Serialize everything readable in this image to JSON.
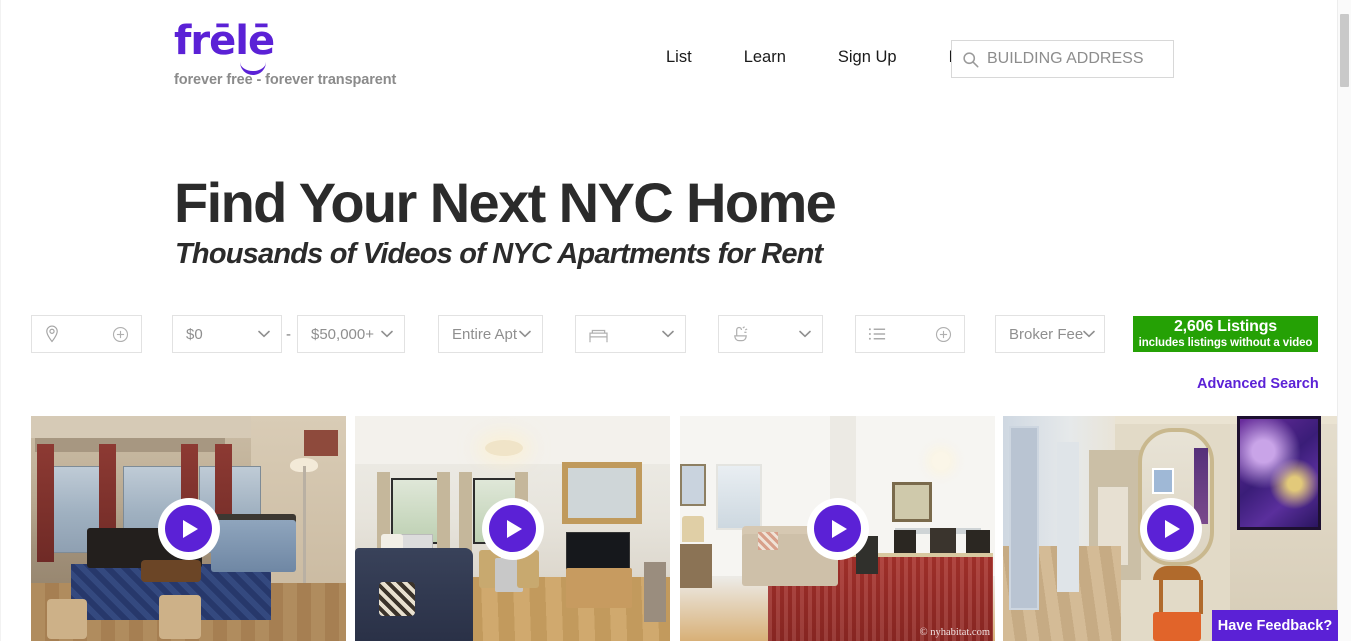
{
  "header": {
    "logo_text": "frēlē",
    "tagline": "forever free - forever transparent",
    "nav": [
      {
        "label": "List"
      },
      {
        "label": "Learn"
      },
      {
        "label": "Sign Up"
      },
      {
        "label": "Login"
      }
    ],
    "search": {
      "placeholder": "BUILDING ADDRESS",
      "value": "",
      "icon": "search-icon"
    }
  },
  "hero": {
    "title": "Find Your Next NYC Home",
    "subtitle": "Thousands of Videos of NYC Apartments for Rent"
  },
  "filters": {
    "neighborhood": {
      "icon": "location-pin-icon",
      "add_icon": "circle-plus-icon",
      "value": ""
    },
    "price_min": {
      "value": "$0",
      "chevron": "chevron-down-icon"
    },
    "price_separator": "-",
    "price_max": {
      "value": "$50,000+",
      "chevron": "chevron-down-icon"
    },
    "apartment_type": {
      "value": "Entire Apt",
      "chevron": "chevron-down-icon"
    },
    "bedrooms": {
      "icon": "bed-icon",
      "value": "",
      "chevron": "chevron-down-icon"
    },
    "bathrooms": {
      "icon": "shower-icon",
      "value": "",
      "chevron": "chevron-down-icon"
    },
    "amenities": {
      "icon": "list-icon",
      "add_icon": "circle-plus-icon",
      "value": ""
    },
    "broker_fee": {
      "value": "Broker Fee",
      "chevron": "chevron-down-icon"
    },
    "listings_button": {
      "main": "2,606 Listings",
      "sub": "includes listings without a video",
      "color": "#25a105"
    },
    "advanced_search": "Advanced Search"
  },
  "listings": [
    {
      "name": "listing-card-1",
      "alt": "Studio apartment with city view windows, dark red curtains, black sofa and bed",
      "play_icon": "play-icon",
      "watermark": ""
    },
    {
      "name": "listing-card-2",
      "alt": "Living room with ceiling light, blue sofa, dining set, TV on wooden stand and framed mirror",
      "play_icon": "play-icon",
      "watermark": ""
    },
    {
      "name": "listing-card-3",
      "alt": "White living room with beige sofa, red persian rug and dining table with dark chairs",
      "play_icon": "play-icon",
      "watermark": "© nyhabitat.com"
    },
    {
      "name": "listing-card-4",
      "alt": "Hallway with arched mirror, purple abstract painting and wooden chair with orange seat",
      "play_icon": "play-icon",
      "watermark": ""
    }
  ],
  "feedback": {
    "label": "Have Feedback?",
    "color": "#5b21d6"
  },
  "theme": {
    "brand_purple": "#5b21d6",
    "accent_green": "#25a105",
    "text_dark": "#2b2b2b",
    "text_muted": "#8f8f8f",
    "border": "#e2e2e2"
  }
}
